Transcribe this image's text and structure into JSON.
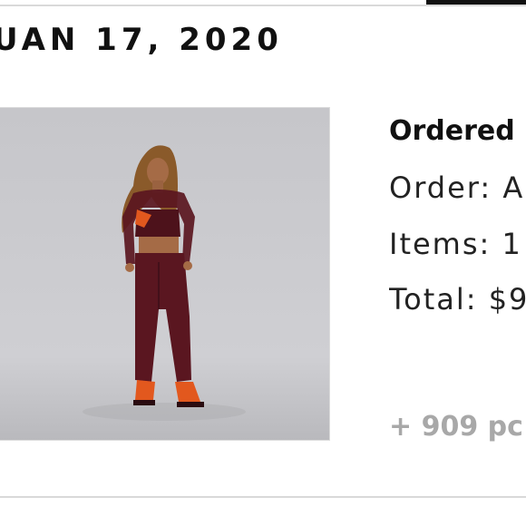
{
  "order": {
    "date": "UAN 17, 2020",
    "status": "Ordered",
    "order_label": "Order: A",
    "items_label": "Items: 1",
    "total_label": "Total: $9",
    "more_products": "+ 909 pc"
  },
  "image": {
    "icon": "product-photo",
    "colors": {
      "background": "#c8c8cc",
      "outfit": "#5a1620",
      "accent": "#e2581e"
    }
  }
}
